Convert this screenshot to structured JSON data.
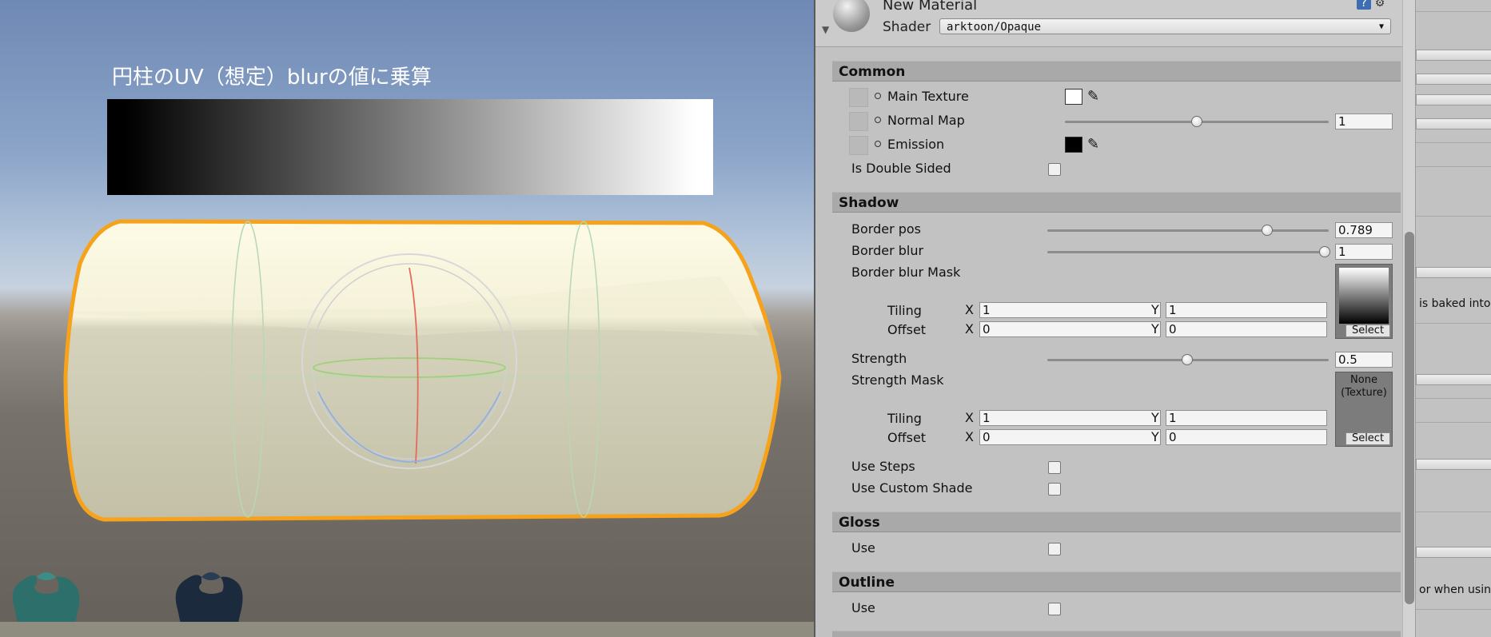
{
  "scene": {
    "caption": "円柱のUV（想定）blurの値に乗算"
  },
  "inspector": {
    "material_name": "New Material",
    "shader_label": "Shader",
    "shader_value": "arktoon/Opaque",
    "sections": {
      "common": "Common",
      "shadow": "Shadow",
      "gloss": "Gloss",
      "outline": "Outline"
    },
    "common": {
      "main_texture": "Main Texture",
      "normal_map": "Normal Map",
      "normal_map_value": "1",
      "normal_map_level": 0.5,
      "emission": "Emission",
      "main_texture_color": "#ffffff",
      "emission_color": "#000000",
      "is_double_sided": "Is Double Sided"
    },
    "shadow": {
      "border_pos": "Border pos",
      "border_pos_value": "0.789",
      "border_blur": "Border blur",
      "border_blur_value": "1",
      "border_blur_mask": "Border blur Mask",
      "tiling": "Tiling",
      "offset": "Offset",
      "x": "X",
      "y": "Y",
      "mask_tiling_x": "1",
      "mask_tiling_y": "1",
      "mask_offset_x": "0",
      "mask_offset_y": "0",
      "select": "Select",
      "strength": "Strength",
      "strength_value": "0.5",
      "strength_mask": "Strength Mask",
      "none_texture": "None (Texture)",
      "smask_tiling_x": "1",
      "smask_tiling_y": "1",
      "smask_offset_x": "0",
      "smask_offset_y": "0",
      "use_steps": "Use Steps",
      "use_custom_shade": "Use Custom Shade"
    },
    "gloss": {
      "use": "Use"
    },
    "outline": {
      "use": "Use"
    }
  },
  "right_panel": {
    "snippet1": "is baked into",
    "snippet2": "or when using"
  }
}
